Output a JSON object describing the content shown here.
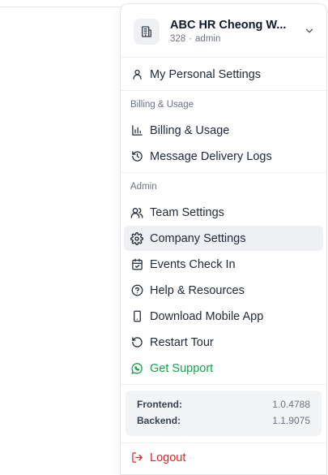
{
  "org": {
    "name": "ABC HR Cheong W...",
    "id": "328",
    "separator": "·",
    "role": "admin"
  },
  "menu": {
    "personal_settings": "My Personal Settings",
    "billing_section_label": "Billing & Usage",
    "billing_usage": "Billing & Usage",
    "message_delivery_logs": "Message Delivery Logs",
    "admin_section_label": "Admin",
    "team_settings": "Team Settings",
    "company_settings": "Company Settings",
    "events_check_in": "Events Check In",
    "help_resources": "Help & Resources",
    "download_mobile_app": "Download Mobile App",
    "restart_tour": "Restart Tour",
    "get_support": "Get Support",
    "logout": "Logout"
  },
  "versions": {
    "frontend_label": "Frontend:",
    "frontend_value": "1.0.4788",
    "backend_label": "Backend:",
    "backend_value": "1.1.9075"
  },
  "colors": {
    "support_green": "#16a34a",
    "logout_red": "#dc2626",
    "active_bg": "#eef0f3"
  },
  "icons": {
    "org": "building-icon",
    "chevron": "chevron-down-icon",
    "personal": "user-icon",
    "billing": "bar-chart-icon",
    "logs": "history-icon",
    "team": "users-icon",
    "company": "gear-icon",
    "events": "calendar-check-icon",
    "help": "help-circle-icon",
    "mobile": "smartphone-icon",
    "tour": "restart-icon",
    "support": "whatsapp-icon",
    "logout": "logout-icon"
  }
}
